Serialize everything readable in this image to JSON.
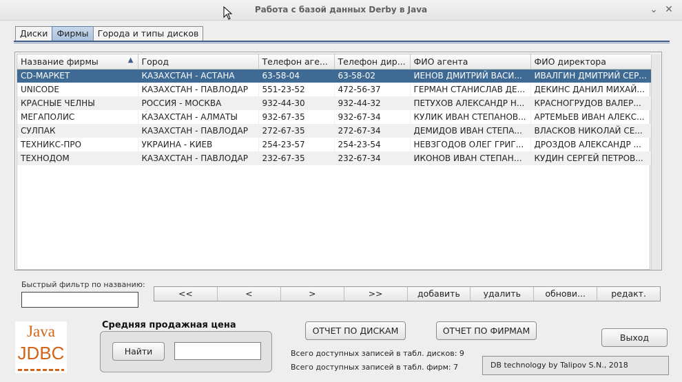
{
  "window": {
    "title": "Работа с базой данных Derby в Java",
    "minimize_glyph": "⌄",
    "close_glyph": "✕"
  },
  "tabs": [
    {
      "label": "Диски",
      "active": false
    },
    {
      "label": "Фирмы",
      "active": true
    },
    {
      "label": "Города и типы дисков",
      "active": false
    }
  ],
  "table": {
    "columns": [
      "Название фирмы",
      "Город",
      "Телефон аге...",
      "Телефон дир...",
      "ФИО агента",
      "ФИО директора"
    ],
    "sort_icon": "sort-ascending-icon",
    "rows": [
      [
        "CD-МАРКЕТ",
        "КАЗАХСТАН - АСТАНА",
        "63-58-04",
        "63-58-02",
        "ИЕНОВ ДМИТРИЙ ВАСИ...",
        "ИВАЛГИН ДМИТРИЙ СЕР..."
      ],
      [
        "UNICODE",
        "КАЗАХСТАН - ПАВЛОДАР",
        "551-23-52",
        "472-56-37",
        "ГЕРМАН СТАНИСЛАВ ДЕ...",
        "ДЕКИНС ДАНИЛ МИХАЙ..."
      ],
      [
        "КРАСНЫЕ ЧЕЛНЫ",
        "РОССИЯ - МОСКВА",
        "932-44-30",
        "932-44-32",
        "ПЕТУХОВ АЛЕКСАНДР Н...",
        "КРАСНОГРУДОВ ВАЛЕР..."
      ],
      [
        "МЕГАПОЛИС",
        "КАЗАХСТАН - АЛМАТЫ",
        "932-67-35",
        "932-67-34",
        "КУЛИК ИВАН СТЕПАНОВ...",
        "АРТЕМЬЕВ ИВАН АЛЕКС..."
      ],
      [
        "СУЛПАК",
        "КАЗАХСТАН - ПАВЛОДАР",
        "272-67-35",
        "272-67-34",
        "ДЕМИДОВ ИВАН СТЕПА...",
        "ВЛАСКОВ НИКОЛАЙ СЕ..."
      ],
      [
        "ТЕХНИКС-ПРО",
        "УКРАИНА - КИЕВ",
        "254-23-57",
        "254-23-54",
        "НЕВЗГОДОВ ОЛЕГ ГРИГ...",
        "ДРОЗДОВ АЛЕКСАНДР ..."
      ],
      [
        "ТЕХНОДОМ",
        "КАЗАХСТАН - ПАВЛОДАР",
        "232-67-35",
        "232-67-34",
        "ИКОНОВ ИВАН СТЕПАНО...",
        "КУДИН СЕРГЕЙ ПЕТРОВ..."
      ]
    ],
    "selected_row": 0
  },
  "filter": {
    "label": "Быстрый фильтр по названию:",
    "value": ""
  },
  "nav_buttons": [
    "<<",
    "<",
    ">",
    ">>",
    "добавить",
    "удалить",
    "обнови...",
    "редакт."
  ],
  "avg_price": {
    "title": "Средняя продажная цена",
    "find_label": "Найти",
    "value": ""
  },
  "reports": {
    "disks_label": "ОТЧЕТ ПО ДИСКАМ",
    "firms_label": "ОТЧЕТ ПО ФИРМАМ"
  },
  "stats": {
    "disks": "Всего доступных записей в табл. дисков: 9",
    "firms": "Всего доступных записей в табл. фирм: 7"
  },
  "exit_label": "Выход",
  "credit": "DB technology by Talipov S.N., 2018",
  "logo": {
    "line1": "Java",
    "line2": "JDBC"
  },
  "colors": {
    "selection": "#3f6a93",
    "logo": "#d2641a",
    "tab_active": "#a9c0dd"
  }
}
